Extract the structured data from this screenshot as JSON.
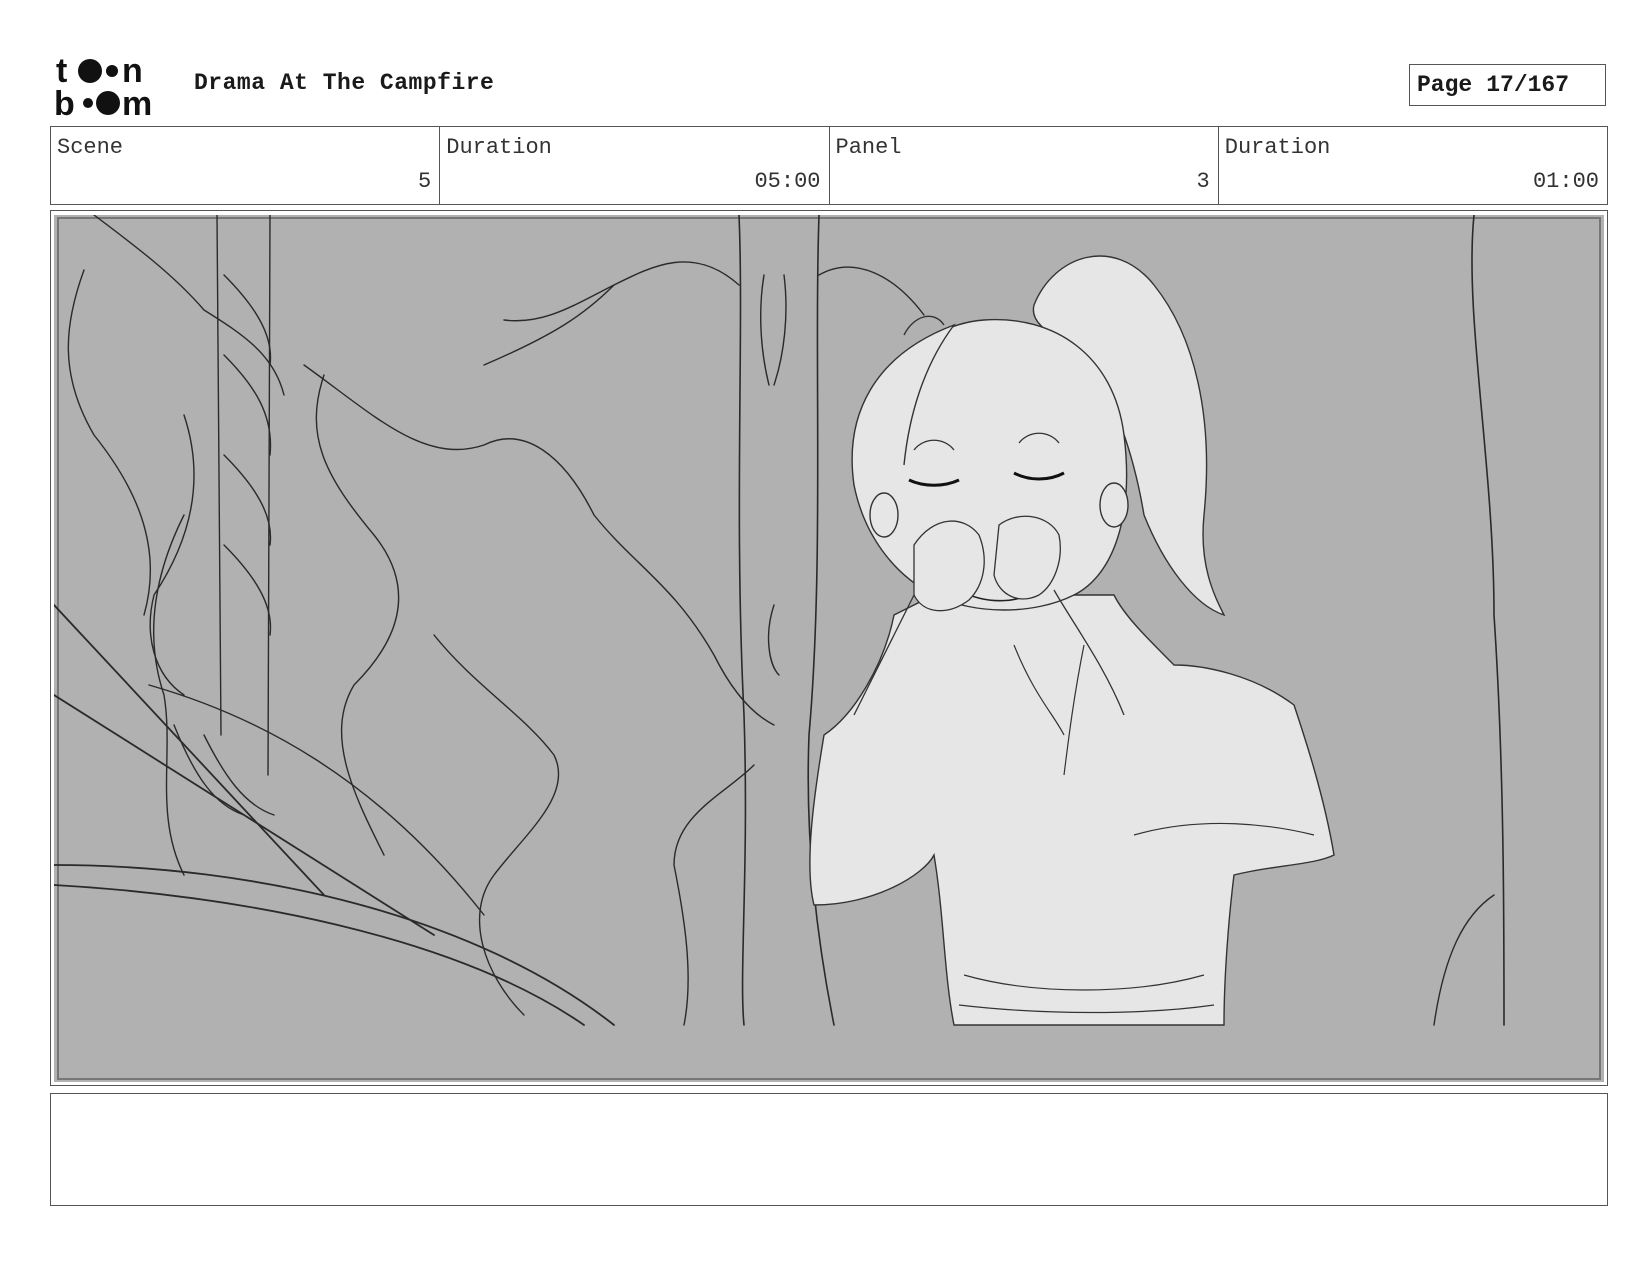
{
  "header": {
    "logo_text": "toon boom",
    "title": "Drama At The Campfire",
    "page_label": "Page",
    "page_number": "17/167"
  },
  "info": {
    "scene_label": "Scene",
    "scene_value": "5",
    "scene_duration_label": "Duration",
    "scene_duration_value": "05:00",
    "panel_label": "Panel",
    "panel_value": "3",
    "panel_duration_label": "Duration",
    "panel_duration_value": "01:00"
  },
  "panel": {
    "icon": "storyboard-sketch",
    "background_color": "#b1b1b1",
    "figure_color": "#e6e6e6"
  },
  "notes": {
    "text": ""
  }
}
